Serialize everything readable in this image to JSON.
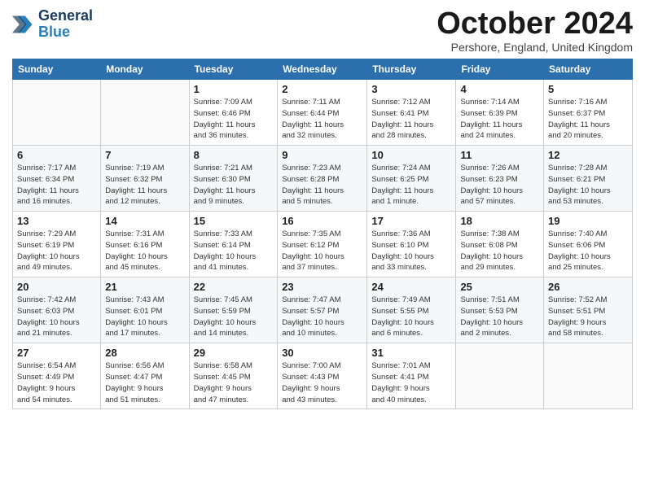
{
  "logo": {
    "line1": "General",
    "line2": "Blue"
  },
  "header": {
    "month": "October 2024",
    "location": "Pershore, England, United Kingdom"
  },
  "weekdays": [
    "Sunday",
    "Monday",
    "Tuesday",
    "Wednesday",
    "Thursday",
    "Friday",
    "Saturday"
  ],
  "weeks": [
    [
      {
        "day": "",
        "info": ""
      },
      {
        "day": "",
        "info": ""
      },
      {
        "day": "1",
        "info": "Sunrise: 7:09 AM\nSunset: 6:46 PM\nDaylight: 11 hours\nand 36 minutes."
      },
      {
        "day": "2",
        "info": "Sunrise: 7:11 AM\nSunset: 6:44 PM\nDaylight: 11 hours\nand 32 minutes."
      },
      {
        "day": "3",
        "info": "Sunrise: 7:12 AM\nSunset: 6:41 PM\nDaylight: 11 hours\nand 28 minutes."
      },
      {
        "day": "4",
        "info": "Sunrise: 7:14 AM\nSunset: 6:39 PM\nDaylight: 11 hours\nand 24 minutes."
      },
      {
        "day": "5",
        "info": "Sunrise: 7:16 AM\nSunset: 6:37 PM\nDaylight: 11 hours\nand 20 minutes."
      }
    ],
    [
      {
        "day": "6",
        "info": "Sunrise: 7:17 AM\nSunset: 6:34 PM\nDaylight: 11 hours\nand 16 minutes."
      },
      {
        "day": "7",
        "info": "Sunrise: 7:19 AM\nSunset: 6:32 PM\nDaylight: 11 hours\nand 12 minutes."
      },
      {
        "day": "8",
        "info": "Sunrise: 7:21 AM\nSunset: 6:30 PM\nDaylight: 11 hours\nand 9 minutes."
      },
      {
        "day": "9",
        "info": "Sunrise: 7:23 AM\nSunset: 6:28 PM\nDaylight: 11 hours\nand 5 minutes."
      },
      {
        "day": "10",
        "info": "Sunrise: 7:24 AM\nSunset: 6:25 PM\nDaylight: 11 hours\nand 1 minute."
      },
      {
        "day": "11",
        "info": "Sunrise: 7:26 AM\nSunset: 6:23 PM\nDaylight: 10 hours\nand 57 minutes."
      },
      {
        "day": "12",
        "info": "Sunrise: 7:28 AM\nSunset: 6:21 PM\nDaylight: 10 hours\nand 53 minutes."
      }
    ],
    [
      {
        "day": "13",
        "info": "Sunrise: 7:29 AM\nSunset: 6:19 PM\nDaylight: 10 hours\nand 49 minutes."
      },
      {
        "day": "14",
        "info": "Sunrise: 7:31 AM\nSunset: 6:16 PM\nDaylight: 10 hours\nand 45 minutes."
      },
      {
        "day": "15",
        "info": "Sunrise: 7:33 AM\nSunset: 6:14 PM\nDaylight: 10 hours\nand 41 minutes."
      },
      {
        "day": "16",
        "info": "Sunrise: 7:35 AM\nSunset: 6:12 PM\nDaylight: 10 hours\nand 37 minutes."
      },
      {
        "day": "17",
        "info": "Sunrise: 7:36 AM\nSunset: 6:10 PM\nDaylight: 10 hours\nand 33 minutes."
      },
      {
        "day": "18",
        "info": "Sunrise: 7:38 AM\nSunset: 6:08 PM\nDaylight: 10 hours\nand 29 minutes."
      },
      {
        "day": "19",
        "info": "Sunrise: 7:40 AM\nSunset: 6:06 PM\nDaylight: 10 hours\nand 25 minutes."
      }
    ],
    [
      {
        "day": "20",
        "info": "Sunrise: 7:42 AM\nSunset: 6:03 PM\nDaylight: 10 hours\nand 21 minutes."
      },
      {
        "day": "21",
        "info": "Sunrise: 7:43 AM\nSunset: 6:01 PM\nDaylight: 10 hours\nand 17 minutes."
      },
      {
        "day": "22",
        "info": "Sunrise: 7:45 AM\nSunset: 5:59 PM\nDaylight: 10 hours\nand 14 minutes."
      },
      {
        "day": "23",
        "info": "Sunrise: 7:47 AM\nSunset: 5:57 PM\nDaylight: 10 hours\nand 10 minutes."
      },
      {
        "day": "24",
        "info": "Sunrise: 7:49 AM\nSunset: 5:55 PM\nDaylight: 10 hours\nand 6 minutes."
      },
      {
        "day": "25",
        "info": "Sunrise: 7:51 AM\nSunset: 5:53 PM\nDaylight: 10 hours\nand 2 minutes."
      },
      {
        "day": "26",
        "info": "Sunrise: 7:52 AM\nSunset: 5:51 PM\nDaylight: 9 hours\nand 58 minutes."
      }
    ],
    [
      {
        "day": "27",
        "info": "Sunrise: 6:54 AM\nSunset: 4:49 PM\nDaylight: 9 hours\nand 54 minutes."
      },
      {
        "day": "28",
        "info": "Sunrise: 6:56 AM\nSunset: 4:47 PM\nDaylight: 9 hours\nand 51 minutes."
      },
      {
        "day": "29",
        "info": "Sunrise: 6:58 AM\nSunset: 4:45 PM\nDaylight: 9 hours\nand 47 minutes."
      },
      {
        "day": "30",
        "info": "Sunrise: 7:00 AM\nSunset: 4:43 PM\nDaylight: 9 hours\nand 43 minutes."
      },
      {
        "day": "31",
        "info": "Sunrise: 7:01 AM\nSunset: 4:41 PM\nDaylight: 9 hours\nand 40 minutes."
      },
      {
        "day": "",
        "info": ""
      },
      {
        "day": "",
        "info": ""
      }
    ]
  ]
}
